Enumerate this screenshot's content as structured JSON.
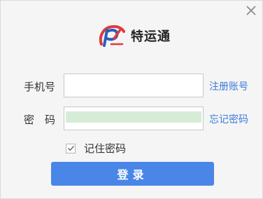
{
  "header": {
    "close_icon": "close-icon",
    "app_name": "特运通",
    "logo_icon": "brand-logo-icon"
  },
  "form": {
    "phone_label": "手机号",
    "phone_value": "",
    "register_link": "注册账号",
    "password_label": "密　码",
    "password_value": "",
    "forgot_link": "忘记密码",
    "remember_label": "记住密码",
    "remember_checked": true,
    "login_label": "登录"
  },
  "colors": {
    "accent": "#4a86e8",
    "link": "#3b7cd8",
    "autofill": "#d6ecd7",
    "logo_red": "#e03a3a",
    "logo_blue": "#2a5fbf"
  }
}
